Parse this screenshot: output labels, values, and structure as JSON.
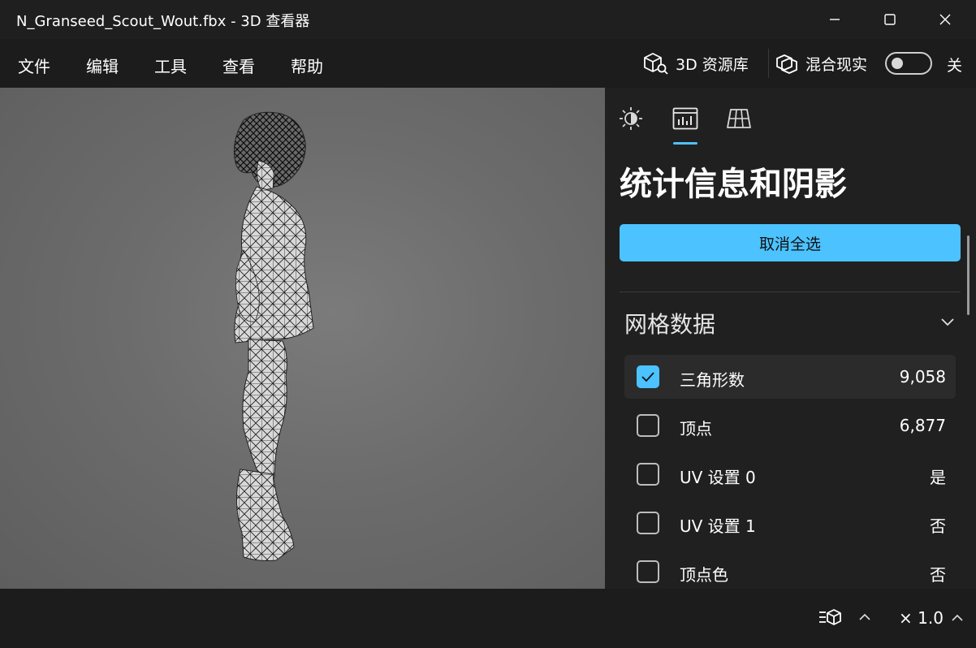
{
  "window": {
    "title": "N_Granseed_Scout_Wout.fbx - 3D 查看器"
  },
  "menu": {
    "items": [
      "文件",
      "编辑",
      "工具",
      "查看",
      "帮助"
    ],
    "library_label": "3D 资源库",
    "mixed_reality_label": "混合现实",
    "mixed_reality_state": "关"
  },
  "panel": {
    "title": "统计信息和阴影",
    "deselect_all": "取消全选",
    "section_title": "网格数据",
    "rows": [
      {
        "label": "三角形数",
        "value": "9,058",
        "checked": true
      },
      {
        "label": "顶点",
        "value": "6,877",
        "checked": false
      },
      {
        "label": "UV 设置 0",
        "value": "是",
        "checked": false
      },
      {
        "label": "UV 设置 1",
        "value": "否",
        "checked": false
      },
      {
        "label": "顶点色",
        "value": "否",
        "checked": false
      }
    ]
  },
  "status": {
    "zoom": "× 1.0"
  },
  "icons": {
    "minimize": "minimize-icon",
    "maximize": "maximize-icon",
    "close": "close-icon",
    "library": "cube-search-icon",
    "mixed_reality": "mixed-reality-icon",
    "lighting_tab": "sun-icon",
    "stats_tab": "stats-chart-icon",
    "grid_tab": "grid-icon",
    "section_chevron": "chevron-down-icon",
    "animation": "animation-icon",
    "zoom_chevron": "chevron-up-icon"
  },
  "colors": {
    "accent": "#4cc2ff",
    "background": "#1c1c1c",
    "panel": "#202020",
    "viewport": "#6c6c6c"
  }
}
